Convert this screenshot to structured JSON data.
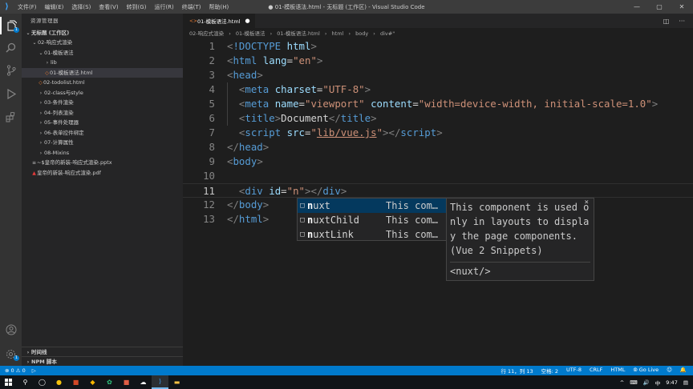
{
  "titlebar": {
    "menus": [
      "文件(F)",
      "编辑(E)",
      "选择(S)",
      "查看(V)",
      "转到(G)",
      "运行(R)",
      "终端(T)",
      "帮助(H)"
    ],
    "title": "● 01-模板语法.html - 无标题 (工作区) - Visual Studio Code",
    "controls": [
      "—",
      "▢",
      "✕"
    ]
  },
  "activity": {
    "icons": [
      "explorer-icon",
      "search-icon",
      "source-control-icon",
      "run-debug-icon",
      "extensions-icon",
      "account-icon",
      "settings-gear-icon"
    ],
    "explorer_badge": "1"
  },
  "sidebar": {
    "title": "资源管理器",
    "root": "无标题 (工作区)",
    "tree": [
      {
        "label": "02-响应式渲染",
        "depth": 1,
        "kind": "folder-open"
      },
      {
        "label": "01-模板语法",
        "depth": 2,
        "kind": "folder-open"
      },
      {
        "label": "lib",
        "depth": 3,
        "kind": "folder"
      },
      {
        "label": "01-模板语法.html",
        "depth": 3,
        "kind": "html",
        "selected": true
      },
      {
        "label": "02-todolist.html",
        "depth": 2,
        "kind": "html"
      },
      {
        "label": "02-class与style",
        "depth": 2,
        "kind": "folder"
      },
      {
        "label": "03-条件渲染",
        "depth": 2,
        "kind": "folder"
      },
      {
        "label": "04-列表渲染",
        "depth": 2,
        "kind": "folder"
      },
      {
        "label": "05-事件处理器",
        "depth": 2,
        "kind": "folder"
      },
      {
        "label": "06-表单控件绑定",
        "depth": 2,
        "kind": "folder"
      },
      {
        "label": "07-计算属性",
        "depth": 2,
        "kind": "folder"
      },
      {
        "label": "08-Mixins",
        "depth": 2,
        "kind": "folder"
      },
      {
        "label": "~$皇帝的新装-响应式渲染.pptx",
        "depth": 1,
        "kind": "pptx"
      },
      {
        "label": "皇帝的新装-响应式渲染.pdf",
        "depth": 1,
        "kind": "pdf"
      }
    ],
    "timeline": "时间线",
    "npm": "NPM 脚本"
  },
  "editor": {
    "tab_label": "01-模板语法.html",
    "breadcrumb": [
      "02-响应式渲染",
      "›",
      "01-模板语法",
      "›",
      "01-模板语法.html",
      "›",
      "html",
      "›",
      "body",
      "›",
      "div#\""
    ],
    "lines": [
      {
        "n": "1",
        "parts": [
          [
            "p",
            "<"
          ],
          [
            "t",
            "!DOCTYPE"
          ],
          [
            "w",
            " "
          ],
          [
            "a",
            "html"
          ],
          [
            "p",
            ">"
          ]
        ]
      },
      {
        "n": "2",
        "parts": [
          [
            "p",
            "<"
          ],
          [
            "t",
            "html"
          ],
          [
            "w",
            " "
          ],
          [
            "a",
            "lang"
          ],
          [
            "w",
            "="
          ],
          [
            "s",
            "\"en\""
          ],
          [
            "p",
            ">"
          ]
        ]
      },
      {
        "n": "3",
        "parts": [
          [
            "p",
            "<"
          ],
          [
            "t",
            "head"
          ],
          [
            "p",
            ">"
          ]
        ]
      },
      {
        "n": "4",
        "parts": [
          [
            "w",
            "  "
          ],
          [
            "p",
            "<"
          ],
          [
            "t",
            "meta"
          ],
          [
            "w",
            " "
          ],
          [
            "a",
            "charset"
          ],
          [
            "w",
            "="
          ],
          [
            "s",
            "\"UTF-8\""
          ],
          [
            "p",
            ">"
          ]
        ]
      },
      {
        "n": "5",
        "parts": [
          [
            "w",
            "  "
          ],
          [
            "p",
            "<"
          ],
          [
            "t",
            "meta"
          ],
          [
            "w",
            " "
          ],
          [
            "a",
            "name"
          ],
          [
            "w",
            "="
          ],
          [
            "s",
            "\"viewport\""
          ],
          [
            "w",
            " "
          ],
          [
            "a",
            "content"
          ],
          [
            "w",
            "="
          ],
          [
            "s",
            "\"width=device-width, initial-scale=1.0\""
          ],
          [
            "p",
            ">"
          ]
        ]
      },
      {
        "n": "6",
        "parts": [
          [
            "w",
            "  "
          ],
          [
            "p",
            "<"
          ],
          [
            "t",
            "title"
          ],
          [
            "p",
            ">"
          ],
          [
            "w",
            "Document"
          ],
          [
            "p",
            "</"
          ],
          [
            "t",
            "title"
          ],
          [
            "p",
            ">"
          ]
        ]
      },
      {
        "n": "7",
        "parts": [
          [
            "w",
            "  "
          ],
          [
            "p",
            "<"
          ],
          [
            "t",
            "script"
          ],
          [
            "w",
            " "
          ],
          [
            "a",
            "src"
          ],
          [
            "w",
            "="
          ],
          [
            "s",
            "\""
          ],
          [
            "su",
            "lib/vue.js"
          ],
          [
            "s",
            "\""
          ],
          [
            "p",
            "></"
          ],
          [
            "t",
            "script"
          ],
          [
            "p",
            ">"
          ]
        ]
      },
      {
        "n": "8",
        "parts": [
          [
            "p",
            "</"
          ],
          [
            "t",
            "head"
          ],
          [
            "p",
            ">"
          ]
        ]
      },
      {
        "n": "9",
        "parts": [
          [
            "p",
            "<"
          ],
          [
            "t",
            "body"
          ],
          [
            "p",
            ">"
          ]
        ]
      },
      {
        "n": "10",
        "parts": []
      },
      {
        "n": "11",
        "parts": [
          [
            "w",
            "  "
          ],
          [
            "p",
            "<"
          ],
          [
            "t",
            "div"
          ],
          [
            "w",
            " "
          ],
          [
            "a",
            "id"
          ],
          [
            "w",
            "="
          ],
          [
            "s",
            "\"n\""
          ],
          [
            "p",
            "></"
          ],
          [
            "t",
            "div"
          ],
          [
            "p",
            ">"
          ]
        ]
      },
      {
        "n": "12",
        "parts": [
          [
            "p",
            "</"
          ],
          [
            "t",
            "body"
          ],
          [
            "p",
            ">"
          ]
        ]
      },
      {
        "n": "13",
        "parts": [
          [
            "p",
            "</"
          ],
          [
            "t",
            "html"
          ],
          [
            "p",
            ">"
          ]
        ]
      }
    ],
    "suggestions": [
      {
        "match": "n",
        "rest": "uxt",
        "detail": "This com…"
      },
      {
        "match": "n",
        "rest": "uxtChild",
        "detail": "This com…"
      },
      {
        "match": "n",
        "rest": "uxtLink",
        "detail": "This com…"
      }
    ],
    "doc": {
      "text": "This component is used only in layouts to display the page components. (Vue 2 Snippets)",
      "code": "<nuxt/>",
      "close": "×"
    }
  },
  "status": {
    "problems": "⊗ 0 ⚠ 0",
    "run": "▷",
    "position": "行 11，列 13",
    "spaces": "空格: 2",
    "encoding": "UTF-8",
    "eol": "CRLF",
    "language": "HTML",
    "golive": "⦾ Go Live",
    "icons": [
      "feedback-icon",
      "notification-icon"
    ]
  },
  "taskbar": {
    "apps": [
      "windows-start-icon",
      "search-icon",
      "wechat-icon",
      "chrome-icon",
      "powerpoint-icon",
      "sketch-icon",
      "music-icon",
      "app-icon",
      "photos-icon",
      "vscode-icon",
      "file-explorer-icon"
    ],
    "time": "9:47",
    "tray": [
      "^",
      "⌨",
      "🔊",
      "中"
    ]
  }
}
